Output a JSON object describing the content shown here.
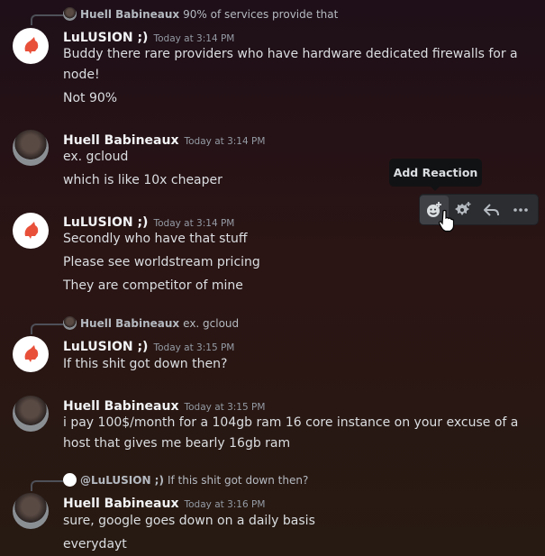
{
  "messages": [
    {
      "reply": {
        "author": "Huell Babineaux",
        "text": "90% of services provide that"
      },
      "author": "LuLUSION ;)",
      "time": "Today at 3:14 PM",
      "lines": [
        "Buddy there rare providers who have hardware dedicated firewalls for a",
        "node!",
        "Not 90%"
      ]
    },
    {
      "author": "Huell Babineaux",
      "time": "Today at 3:14 PM",
      "lines": [
        "ex. gcloud",
        "which is like 10x cheaper"
      ]
    },
    {
      "author": "LuLUSION ;)",
      "time": "Today at 3:14 PM",
      "lines": [
        "Secondly who have that stuff",
        "Please see worldstream pricing",
        "They are competitor of mine"
      ]
    },
    {
      "reply": {
        "author": "Huell Babineaux",
        "text": "ex. gcloud"
      },
      "author": "LuLUSION ;)",
      "time": "Today at 3:15 PM",
      "lines": [
        "If this shit got down then?"
      ]
    },
    {
      "author": "Huell Babineaux",
      "time": "Today at 3:15 PM",
      "lines": [
        "i pay 100$/month for a 104gb ram 16 core instance on your excuse of a",
        "host that gives me bearly 16gb ram"
      ]
    },
    {
      "reply": {
        "author": "@LuLUSION ;)",
        "text": "If this shit got down then?"
      },
      "author": "Huell Babineaux",
      "time": "Today at 3:16 PM",
      "lines": [
        "sure, google goes down on a daily basis",
        "everydayt"
      ]
    }
  ],
  "tooltip": "Add Reaction",
  "toolbar": {
    "icons": [
      "add-reaction-icon",
      "super-reaction-icon",
      "reply-icon",
      "more-icon"
    ]
  },
  "colors": {
    "author": "#f2f3f5",
    "timestamp": "#949ba4",
    "text": "#dbdee1",
    "toolbar": "#2b2d31",
    "tooltip": "#111214"
  }
}
